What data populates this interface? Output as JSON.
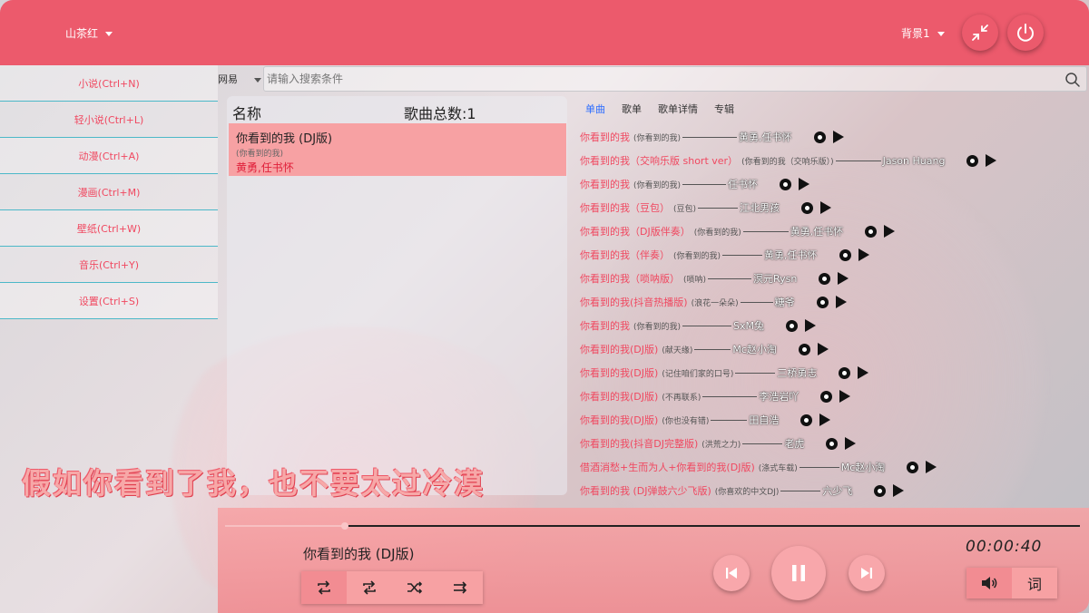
{
  "header": {
    "theme": "山茶红",
    "background": "背景1"
  },
  "sidebar": {
    "items": [
      {
        "label": "小说(Ctrl+N)"
      },
      {
        "label": "轻小说(Ctrl+L)"
      },
      {
        "label": "动漫(Ctrl+A)"
      },
      {
        "label": "漫画(Ctrl+M)"
      },
      {
        "label": "壁纸(Ctrl+W)"
      },
      {
        "label": "音乐(Ctrl+Y)"
      },
      {
        "label": "设置(Ctrl+S)"
      }
    ]
  },
  "search": {
    "source": "网易",
    "placeholder": "请输入搜索条件"
  },
  "playlist": {
    "header_name": "名称",
    "header_count": "歌曲总数:1",
    "items": [
      {
        "title": "你看到的我 (DJ版)",
        "album": "(你看到的我)",
        "artist": "黄勇,任书怀"
      }
    ]
  },
  "tabs": [
    {
      "label": "单曲",
      "active": true
    },
    {
      "label": "歌单",
      "active": false
    },
    {
      "label": "歌单详情",
      "active": false
    },
    {
      "label": "专辑",
      "active": false
    }
  ],
  "results": [
    {
      "name": "你看到的我",
      "album": "(你看到的我)",
      "artist": "黄勇,任书怀"
    },
    {
      "name": "你看到的我（交响乐版 short ver）",
      "album": "(你看到的我（交响乐版）)",
      "artist": "Jason Huang"
    },
    {
      "name": "你看到的我",
      "album": "(你看到的我)",
      "artist": "任书怀"
    },
    {
      "name": "你看到的我（豆包）",
      "album": "(豆包)",
      "artist": "江北男孩"
    },
    {
      "name": "你看到的我（DJ版伴奏）",
      "album": "(你看到的我)",
      "artist": "黄勇,任书怀"
    },
    {
      "name": "你看到的我（伴奏）",
      "album": "(你看到的我)",
      "artist": "黄勇,任书怀"
    },
    {
      "name": "你看到的我（唢呐版）",
      "album": "(唢呐)",
      "artist": "溟元Rysn"
    },
    {
      "name": "你看到的我(抖音热播版)",
      "album": "(浪花一朵朵)",
      "artist": "糖爷"
    },
    {
      "name": "你看到的我",
      "album": "(你看到的我)",
      "artist": "SxM兔"
    },
    {
      "name": "你看到的我(DJ版)",
      "album": "(献天缘)",
      "artist": "Mc赵小淘"
    },
    {
      "name": "你看到的我(DJ版)",
      "album": "(记住咱们家的口号)",
      "artist": "三桥勇志"
    },
    {
      "name": "你看到的我(DJ版)",
      "album": "(不再联系)",
      "artist": "李浩岩吖"
    },
    {
      "name": "你看到的我(DJ版)",
      "album": "(你也没有错)",
      "artist": "田自浩"
    },
    {
      "name": "你看到的我(抖音DJ完整版)",
      "album": "(洪荒之力)",
      "artist": "老虎"
    },
    {
      "name": "借酒消愁+生而为人+你看到的我(DJ版)",
      "album": "(涤式车载)",
      "artist": "Mc赵小淘"
    },
    {
      "name": "你看到的我 (DJ弹鼓六少飞版)",
      "album": "(你喜欢的中文DJ)",
      "artist": "六少飞"
    }
  ],
  "lyric": "假如你看到了我，也不要太过冷漠",
  "player": {
    "now_playing": "你看到的我 (DJ版)",
    "time": "00:00:40",
    "progress": 0.14,
    "lyrics_button": "词"
  },
  "colors": {
    "accent": "#ec5a6c",
    "panel_pink": "#f7a1a3",
    "link_red": "#f04860",
    "active_tab": "#2b6cff"
  }
}
